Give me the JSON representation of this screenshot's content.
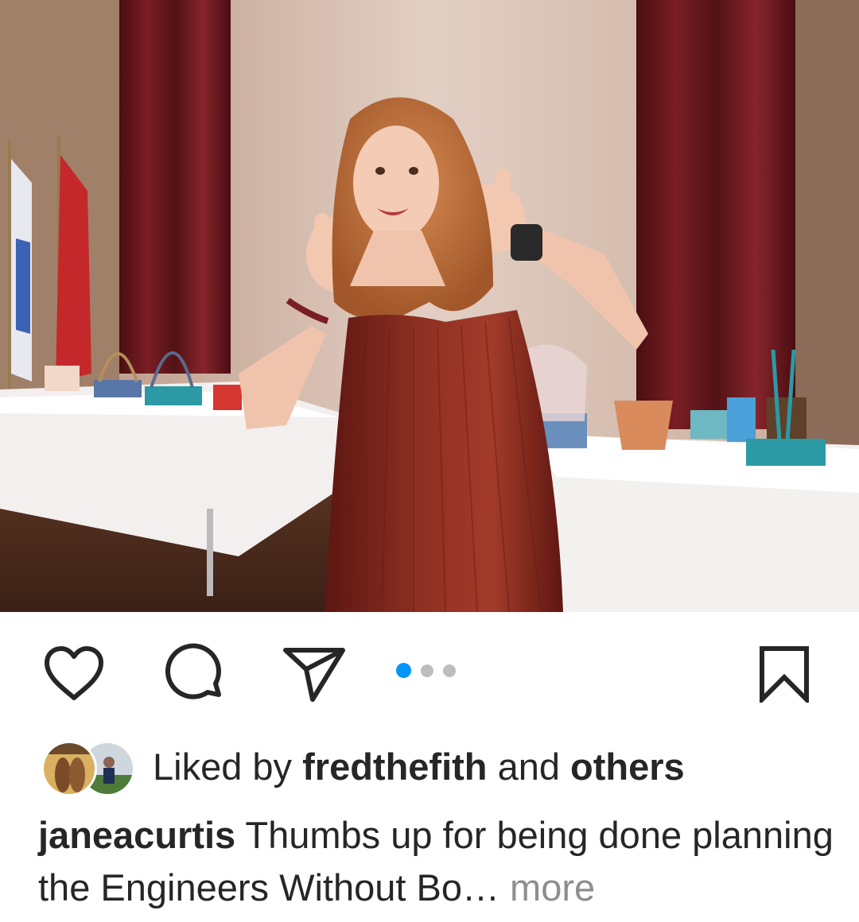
{
  "post": {
    "image_alt": "Woman in a red dress giving two thumbs up in front of tables with raffle baskets",
    "carousel": {
      "count": 3,
      "active": 0
    }
  },
  "actions": {
    "like_icon": "heart-icon",
    "comment_icon": "comment-icon",
    "share_icon": "paper-plane-icon",
    "save_icon": "bookmark-icon"
  },
  "likes": {
    "prefix": "Liked by",
    "user": "fredthefith",
    "conjunction": "and",
    "others": "others"
  },
  "caption": {
    "username": "janeacurtis",
    "text": "Thumbs up for being done planning the Engineers Without Bo…",
    "more": "more"
  },
  "colors": {
    "accent": "#0095f6",
    "text": "#262626",
    "muted": "#8e8e8e"
  }
}
